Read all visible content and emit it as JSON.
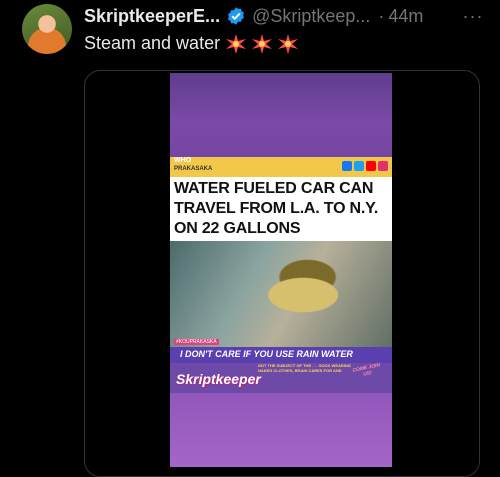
{
  "tweet": {
    "display_name": "SkriptkeeperE...",
    "handle": "@Skriptkeep...",
    "separator": "·",
    "time": "44m",
    "more_label": "···",
    "text": "Steam and water",
    "emojis": [
      "collision-icon",
      "collision-icon",
      "collision-icon"
    ]
  },
  "video": {
    "banner_who": "WHO",
    "banner_sub": "PRAKASAKA",
    "headline": "WATER FUELED CAR CAN TRAVEL FROM L.A. TO N.Y. ON 22 GALLONS",
    "small_tag": "#KOUPRAKASKA",
    "subtitle": "I DON'T CARE IF YOU USE RAIN WATER",
    "brand": "Skriptkeeper",
    "fine_print": "NOT THE SUBJECT OF THE . . . SOCK WEARING NAKED CLOTHES, BRAIN CARES FOR AND",
    "cta": "COME JOIN US!",
    "social_colors": [
      "#1877f2",
      "#1da1f2",
      "#ff0000",
      "#e1306c"
    ]
  },
  "colors": {
    "background": "#000000",
    "text_primary": "#e7e9ea",
    "text_secondary": "#71767b",
    "verified": "#1d9bf0",
    "video_purple": "#7a4aa6",
    "banner_yellow": "#f1c84a"
  }
}
